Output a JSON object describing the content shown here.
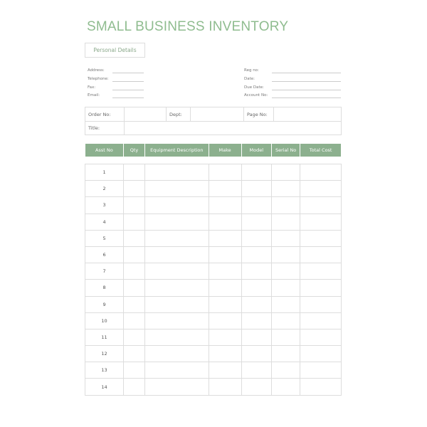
{
  "title": "SMALL BUSINESS INVENTORY",
  "section": "Personal Details",
  "left_fields": [
    "Address:",
    "Telephone:",
    "Fax:",
    "Email:"
  ],
  "right_fields": [
    "Reg no:",
    "Date:",
    "Due Date:",
    "Account No:"
  ],
  "info": {
    "order_no": "Order No:",
    "dept": "Dept:",
    "page_no": "Page No:",
    "title": "Title:"
  },
  "columns": [
    "Asst No",
    "Qty",
    "Equipment Description",
    "Make",
    "Model",
    "Serial No",
    "Total Cost"
  ],
  "rows": [
    "1",
    "2",
    "3",
    "4",
    "5",
    "6",
    "7",
    "8",
    "9",
    "10",
    "11",
    "12",
    "13",
    "14"
  ],
  "colors": {
    "accent": "#8cb08e"
  }
}
